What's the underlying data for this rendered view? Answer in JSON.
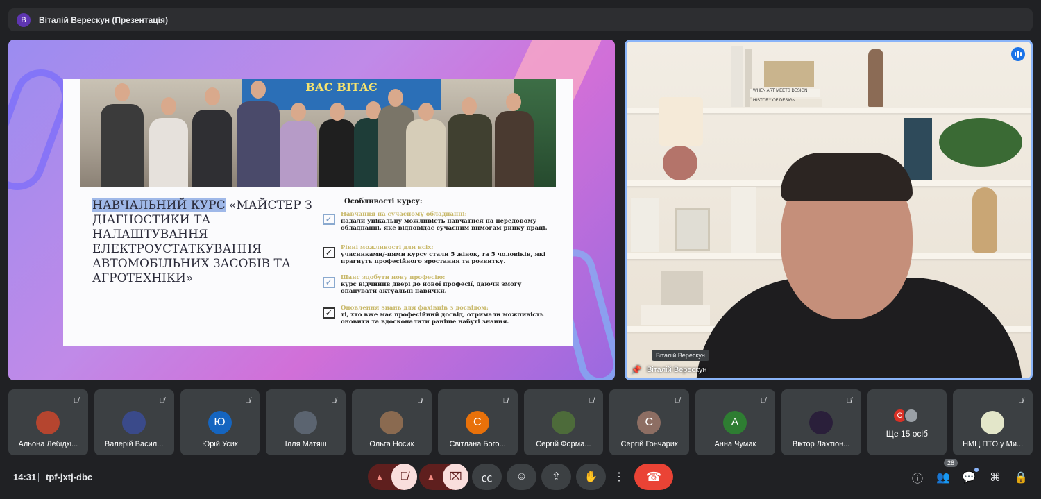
{
  "topbar": {
    "avatar_letter": "В",
    "title": "Віталій Верескун (Презентація)"
  },
  "slide": {
    "banner_text": "ВАС ВІТАЄ",
    "course_title_highlight": "НАВЧАЛЬНИЙ КУРС",
    "course_title_rest": " «МАЙСТЕР З ДІАГНОСТИКИ ТА НАЛАШТУВАННЯ ЕЛЕКТРОУСТАТКУВАННЯ АВТОМОБІЛЬНИХ ЗАСОБІВ ТА АГРОТЕХНІКИ»",
    "features_heading": "Особливості курсу:",
    "features": [
      {
        "title": "Навчання на сучасному обладнанні:",
        "text": "надали унікальну можливість навчатися на передовому обладнанні, яке відповідає сучасним вимогам ринку праці.",
        "style": "light"
      },
      {
        "title": "Рівні можливості для всіх:",
        "text": "учасниками/-цями курсу стали 5 жінок, та 5 чоловіків, які прагнуть професійного зростання та розвитку.",
        "style": "dark"
      },
      {
        "title": "Шанс здобути нову професію:",
        "text": "курс відчинив двері до нової професії, даючи змогу опанувати актуальні навички.",
        "style": "light"
      },
      {
        "title": "Оновлення знань для фахівців з досвідом:",
        "text": "ті, хто вже має професійний досвід, отримали можливість оновити та вдосконалити раніше набуті знання.",
        "style": "dark"
      }
    ]
  },
  "speaker": {
    "tooltip": "Віталій Верескун",
    "label": "Віталій Верескун",
    "book_spine_1": "WHEN ART MEETS DESIGN",
    "book_spine_2": "HISTORY OF DESIGN"
  },
  "participants": [
    {
      "name": "Альона Лебідкі...",
      "avatar": "",
      "color": "#b5452f"
    },
    {
      "name": "Валерій Васил...",
      "avatar": "",
      "color": "#3a4a8a"
    },
    {
      "name": "Юрій Усик",
      "avatar": "Ю",
      "color": "#1565c0"
    },
    {
      "name": "Ілля Матяш",
      "avatar": "",
      "color": "#5b6470"
    },
    {
      "name": "Ольга Носик",
      "avatar": "",
      "color": "#8a6a50"
    },
    {
      "name": "Світлана Бого...",
      "avatar": "С",
      "color": "#e8710a"
    },
    {
      "name": "Сергій Форма...",
      "avatar": "",
      "color": "#4d6b3a"
    },
    {
      "name": "Сергій Гончарик",
      "avatar": "С",
      "color": "#8d6e63"
    },
    {
      "name": "Анна Чумак",
      "avatar": "А",
      "color": "#2e7d32"
    },
    {
      "name": "Віктор Лахтіон...",
      "avatar": "",
      "color": "#2a1f3a"
    }
  ],
  "more": {
    "label": "Ще 15 осіб",
    "avatar_letter": "С"
  },
  "last_participant": {
    "name": "НМЦ ПТО у Ми..."
  },
  "bottombar": {
    "time": "14:31",
    "meeting_code": "tpf-jxtj-dbc",
    "participant_count": "28"
  }
}
